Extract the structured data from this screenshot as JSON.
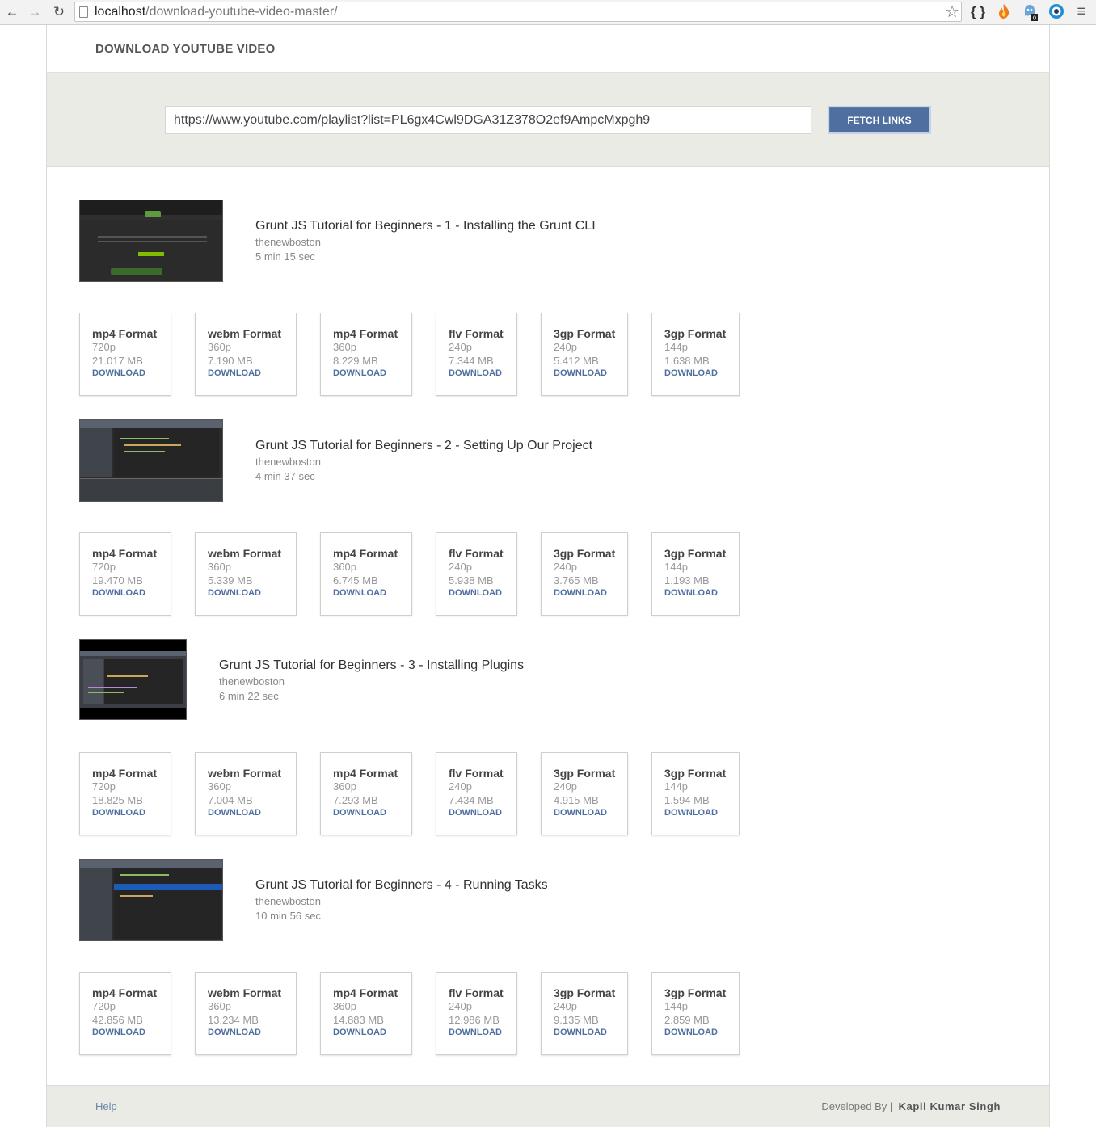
{
  "browser": {
    "back": "←",
    "forward": "→",
    "reload": "↻",
    "url_host": "localhost",
    "url_path": "/download-youtube-video-master/",
    "star": "☆",
    "ext_braces": "{ }",
    "menu": "≡",
    "badge": "0"
  },
  "header": {
    "title": "DOWNLOAD YOUTUBE VIDEO"
  },
  "search": {
    "value": "https://www.youtube.com/playlist?list=PL6gx4Cwl9DGA31Z378O2ef9AmpcMxpgh9",
    "button": "FETCH LINKS"
  },
  "videos": [
    {
      "title": "Grunt JS Tutorial for Beginners - 1 - Installing the Grunt CLI",
      "channel": "thenewboston",
      "duration": "5 min 15 sec",
      "formats": [
        {
          "name": "mp4 Format",
          "res": "720p",
          "size": "21.017 MB",
          "dl": "DOWNLOAD"
        },
        {
          "name": "webm Format",
          "res": "360p",
          "size": "7.190 MB",
          "dl": "DOWNLOAD"
        },
        {
          "name": "mp4 Format",
          "res": "360p",
          "size": "8.229 MB",
          "dl": "DOWNLOAD"
        },
        {
          "name": "flv Format",
          "res": "240p",
          "size": "7.344 MB",
          "dl": "DOWNLOAD"
        },
        {
          "name": "3gp Format",
          "res": "240p",
          "size": "5.412 MB",
          "dl": "DOWNLOAD"
        },
        {
          "name": "3gp Format",
          "res": "144p",
          "size": "1.638 MB",
          "dl": "DOWNLOAD"
        }
      ]
    },
    {
      "title": "Grunt JS Tutorial for Beginners - 2 - Setting Up Our Project",
      "channel": "thenewboston",
      "duration": "4 min 37 sec",
      "formats": [
        {
          "name": "mp4 Format",
          "res": "720p",
          "size": "19.470 MB",
          "dl": "DOWNLOAD"
        },
        {
          "name": "webm Format",
          "res": "360p",
          "size": "5.339 MB",
          "dl": "DOWNLOAD"
        },
        {
          "name": "mp4 Format",
          "res": "360p",
          "size": "6.745 MB",
          "dl": "DOWNLOAD"
        },
        {
          "name": "flv Format",
          "res": "240p",
          "size": "5.938 MB",
          "dl": "DOWNLOAD"
        },
        {
          "name": "3gp Format",
          "res": "240p",
          "size": "3.765 MB",
          "dl": "DOWNLOAD"
        },
        {
          "name": "3gp Format",
          "res": "144p",
          "size": "1.193 MB",
          "dl": "DOWNLOAD"
        }
      ]
    },
    {
      "title": "Grunt JS Tutorial for Beginners - 3 - Installing Plugins",
      "channel": "thenewboston",
      "duration": "6 min 22 sec",
      "formats": [
        {
          "name": "mp4 Format",
          "res": "720p",
          "size": "18.825 MB",
          "dl": "DOWNLOAD"
        },
        {
          "name": "webm Format",
          "res": "360p",
          "size": "7.004 MB",
          "dl": "DOWNLOAD"
        },
        {
          "name": "mp4 Format",
          "res": "360p",
          "size": "7.293 MB",
          "dl": "DOWNLOAD"
        },
        {
          "name": "flv Format",
          "res": "240p",
          "size": "7.434 MB",
          "dl": "DOWNLOAD"
        },
        {
          "name": "3gp Format",
          "res": "240p",
          "size": "4.915 MB",
          "dl": "DOWNLOAD"
        },
        {
          "name": "3gp Format",
          "res": "144p",
          "size": "1.594 MB",
          "dl": "DOWNLOAD"
        }
      ]
    },
    {
      "title": "Grunt JS Tutorial for Beginners - 4 - Running Tasks",
      "channel": "thenewboston",
      "duration": "10 min 56 sec",
      "formats": [
        {
          "name": "mp4 Format",
          "res": "720p",
          "size": "42.856 MB",
          "dl": "DOWNLOAD"
        },
        {
          "name": "webm Format",
          "res": "360p",
          "size": "13.234 MB",
          "dl": "DOWNLOAD"
        },
        {
          "name": "mp4 Format",
          "res": "360p",
          "size": "14.883 MB",
          "dl": "DOWNLOAD"
        },
        {
          "name": "flv Format",
          "res": "240p",
          "size": "12.986 MB",
          "dl": "DOWNLOAD"
        },
        {
          "name": "3gp Format",
          "res": "240p",
          "size": "9.135 MB",
          "dl": "DOWNLOAD"
        },
        {
          "name": "3gp Format",
          "res": "144p",
          "size": "2.859 MB",
          "dl": "DOWNLOAD"
        }
      ]
    }
  ],
  "footer": {
    "help": "Help",
    "developed_by": "Developed By |",
    "author": "Kapil Kumar Singh"
  }
}
